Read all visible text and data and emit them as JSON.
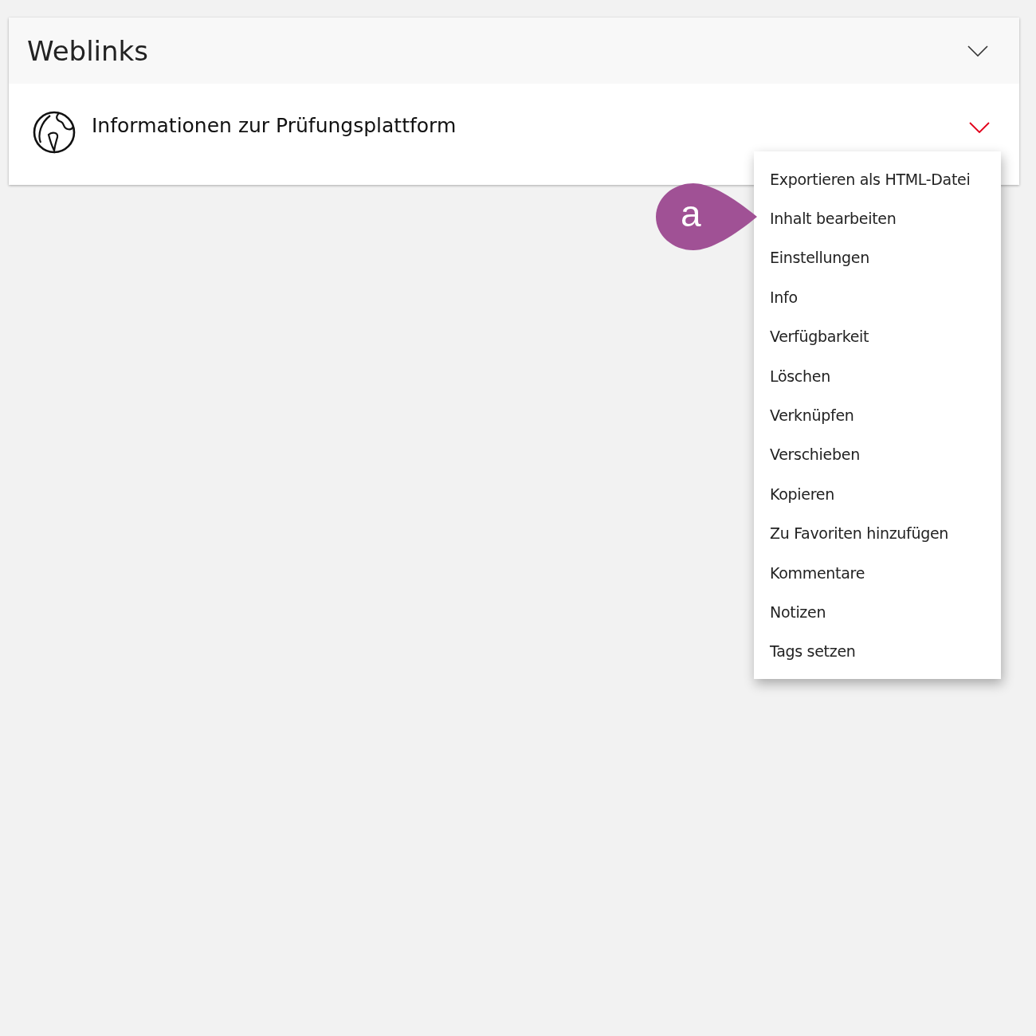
{
  "panel": {
    "title": "Weblinks",
    "expanded": true
  },
  "item": {
    "title": "Informationen zur Prüfungsplattform",
    "actions_open": true
  },
  "actions_menu": [
    {
      "label": "Exportieren als HTML-Datei"
    },
    {
      "label": "Inhalt bearbeiten"
    },
    {
      "label": "Einstellungen"
    },
    {
      "label": "Info"
    },
    {
      "label": "Verfügbarkeit"
    },
    {
      "label": "Löschen"
    },
    {
      "label": "Verknüpfen"
    },
    {
      "label": "Verschieben"
    },
    {
      "label": "Kopieren"
    },
    {
      "label": "Zu Favoriten hinzufügen"
    },
    {
      "label": "Kommentare"
    },
    {
      "label": "Notizen"
    },
    {
      "label": "Tags setzen"
    }
  ],
  "callout": {
    "label": "a"
  }
}
